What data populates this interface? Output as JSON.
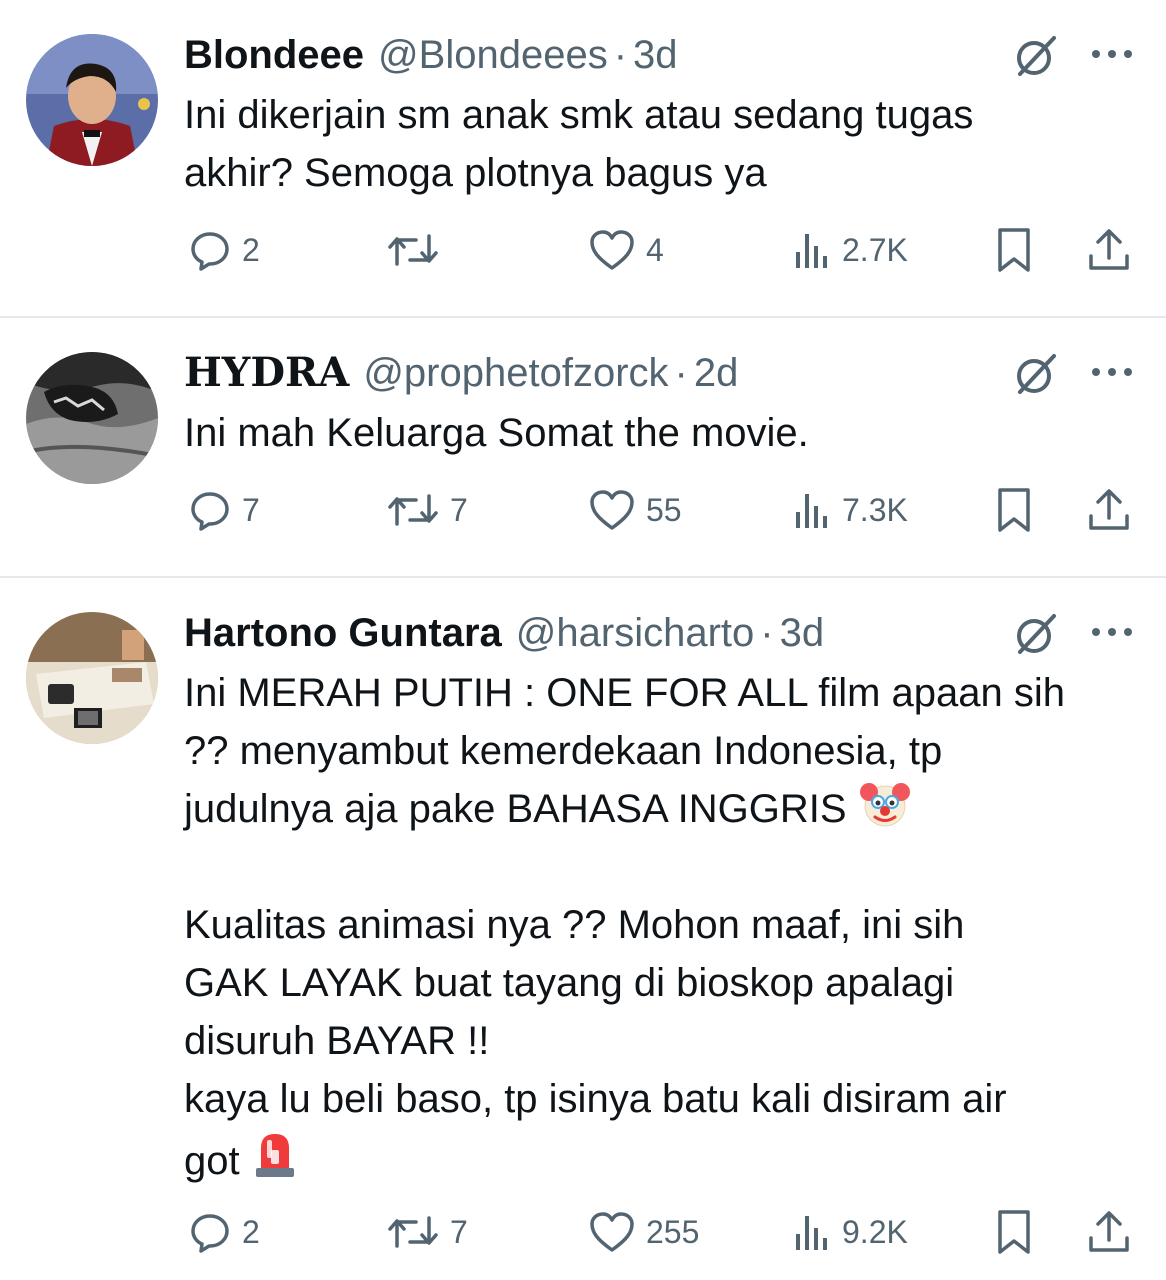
{
  "tweets": [
    {
      "name": "Blondeee",
      "handle": "@Blondeees",
      "time": "3d",
      "text": "Ini dikerjain sm anak smk atau sedang tugas akhir? Semoga plotnya bagus ya",
      "replies": "2",
      "reposts": "",
      "likes": "4",
      "views": "2.7K"
    },
    {
      "name": "HYDRA",
      "handle": "@prophetofzorck",
      "time": "2d",
      "text": "Ini mah Keluarga Somat the movie.",
      "replies": "7",
      "reposts": "7",
      "likes": "55",
      "views": "7.3K"
    },
    {
      "name": "Hartono Guntara",
      "handle": "@harsicharto",
      "time": "3d",
      "text_line1": "Ini MERAH PUTIH : ONE FOR ALL film apaan sih",
      "text_line2": "?? menyambut kemerdekaan Indonesia, tp",
      "text_line3": "judulnya aja pake BAHASA INGGRIS",
      "text_line4": "Kualitas animasi nya ?? Mohon maaf, ini sih",
      "text_line5": "GAK LAYAK buat tayang di bioskop apalagi",
      "text_line6": "disuruh BAYAR !!",
      "text_line7": "kaya lu beli baso, tp isinya batu kali disiram air",
      "text_line8": "got",
      "replies": "2",
      "reposts": "7",
      "likes": "255",
      "views": "9.2K"
    }
  ],
  "colors": {
    "text": "#0f1419",
    "secondary": "#536471",
    "divider": "#e6e9eb"
  },
  "icons": [
    "reply-icon",
    "repost-icon",
    "like-icon",
    "views-icon",
    "bookmark-icon",
    "share-icon",
    "grok-icon",
    "more-icon",
    "clown-emoji",
    "siren-emoji"
  ]
}
